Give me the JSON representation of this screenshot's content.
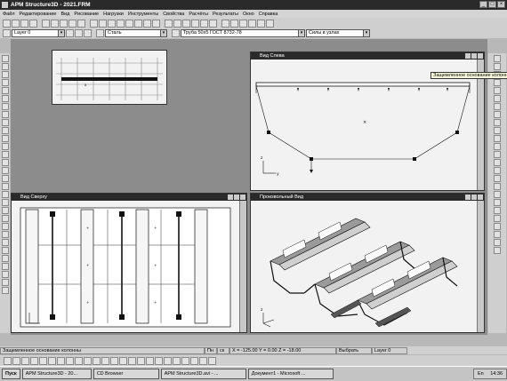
{
  "app": {
    "title": "APM Structure3D - 2021.FRM"
  },
  "menu": [
    "Файл",
    "Редактирование",
    "Вид",
    "Рисование",
    "Нагрузки",
    "Инструменты",
    "Свойства",
    "Расчёты",
    "Результаты",
    "Окно",
    "Справка"
  ],
  "toolbar": {
    "layer": "Layer 0",
    "material": "Сталь",
    "section": "Труба 50х5 ГОСТ 8732-78",
    "mode": "Силы в узлах"
  },
  "windows": {
    "left": "Вид Слева",
    "top": "Вид Сверху",
    "free": "Произвольный Вид"
  },
  "tooltip": "Защемленное основание колонны",
  "status": {
    "hint": "Защемленное основание колонны",
    "cells": [
      "Пн",
      "ск",
      "X = -125.00 Y = 0.00 Z = -18.00",
      "Выбрать",
      "Layer 0"
    ]
  },
  "taskbar": {
    "start": "Пуск",
    "tasks": [
      "APM Structure3D - 20...",
      "CD Browser",
      "APM Structure3D.avi - ...",
      "Документ1 - Microsoft ..."
    ],
    "clock": "14:36",
    "lang": "En"
  }
}
